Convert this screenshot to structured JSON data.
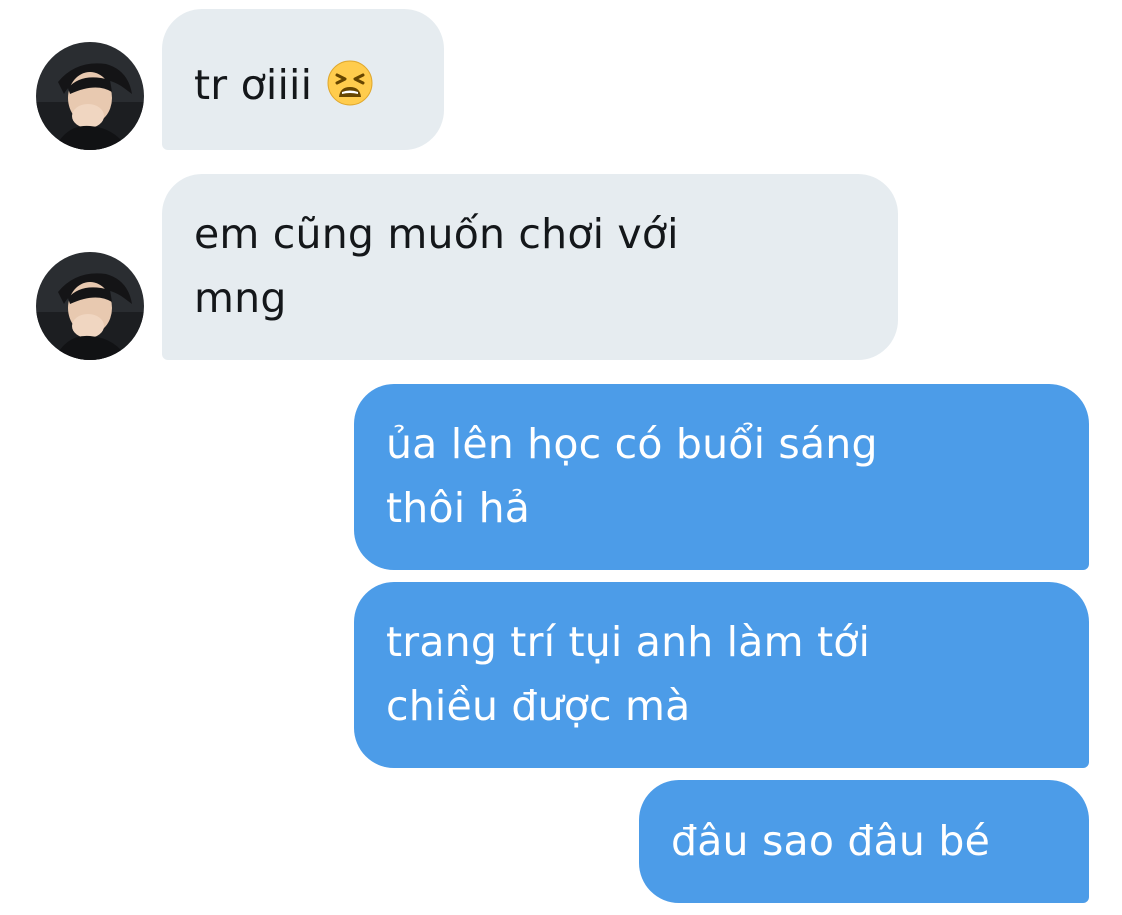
{
  "conversation": {
    "messages": [
      {
        "sender": "other",
        "lines": [
          "tr ơiiii"
        ],
        "emoji": "tired-face-emoji",
        "avatar": "user-avatar"
      },
      {
        "sender": "other",
        "lines": [
          "em cũng muốn chơi với",
          "mng"
        ],
        "avatar": "user-avatar"
      },
      {
        "sender": "me",
        "lines": [
          "ủa lên học có buổi sáng",
          "thôi hả"
        ]
      },
      {
        "sender": "me",
        "lines": [
          "trang trí tụi anh làm tới",
          "chiều được mà"
        ]
      },
      {
        "sender": "me",
        "lines": [
          "đâu sao đâu bé"
        ]
      }
    ]
  },
  "colors": {
    "incoming_bubble": "#e6ecf0",
    "incoming_text": "#14171a",
    "outgoing_bubble": "#4c9ce8",
    "outgoing_text": "#ffffff",
    "background": "#ffffff"
  }
}
